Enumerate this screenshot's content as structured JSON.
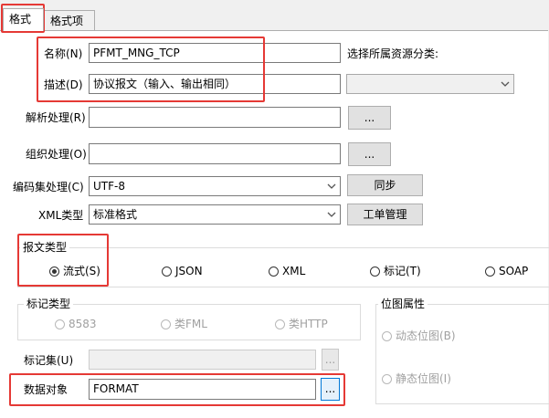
{
  "tabs": [
    {
      "label": "格式"
    },
    {
      "label": "格式项"
    }
  ],
  "form": {
    "name_label": "名称(N)",
    "name_value": "PFMT_MNG_TCP",
    "category_label": "选择所属资源分类:",
    "category_value": "",
    "desc_label": "描述(D)",
    "desc_value": "协议报文（输入、输出相同）",
    "parse_label": "解析处理(R)",
    "parse_value": "",
    "parse_btn": "...",
    "build_label": "组织处理(O)",
    "build_value": "",
    "build_btn": "...",
    "charset_label": "编码集处理(C)",
    "charset_value": "UTF-8",
    "sync_btn": "同步",
    "xmltype_label": "XML类型",
    "xmltype_value": "标准格式",
    "ticket_btn": "工单管理"
  },
  "msgtype": {
    "title": "报文类型",
    "options": [
      {
        "label": "流式(S)",
        "checked": true
      },
      {
        "label": "JSON",
        "checked": false
      },
      {
        "label": "XML",
        "checked": false
      },
      {
        "label": "标记(T)",
        "checked": false
      },
      {
        "label": "SOAP",
        "checked": false
      }
    ]
  },
  "tagtype": {
    "title": "标记类型",
    "options": [
      {
        "label": "8583"
      },
      {
        "label": "类FML"
      },
      {
        "label": "类HTTP"
      }
    ]
  },
  "bitmap": {
    "title": "位图属性",
    "options": [
      {
        "label": "动态位图(B)"
      },
      {
        "label": "静态位图(I)"
      }
    ]
  },
  "tagset": {
    "label": "标记集(U)",
    "value": "",
    "btn": "..."
  },
  "dataobj": {
    "label": "数据对象",
    "value": "FORMAT",
    "btn": "..."
  },
  "colors": {
    "highlight": "#e53935",
    "panel": "#ffffff",
    "chrome": "#f0f0f0"
  }
}
